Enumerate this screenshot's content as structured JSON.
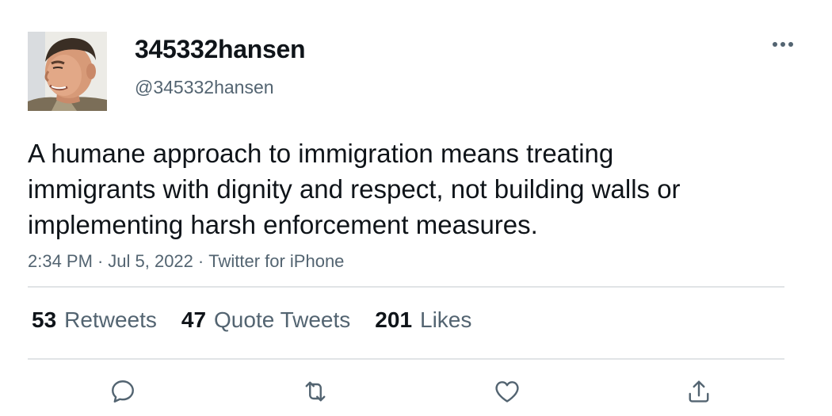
{
  "user": {
    "display_name": "345332hansen",
    "handle": "@345332hansen"
  },
  "tweet": {
    "text": "A humane approach to immigration means treating immigrants with dignity and respect, not building walls or implementing harsh enforcement measures.",
    "time": "2:34 PM",
    "date": "Jul 5, 2022",
    "source": "Twitter for iPhone",
    "separator": "·"
  },
  "stats": {
    "retweets": {
      "count": "53",
      "label": "Retweets"
    },
    "quotes": {
      "count": "47",
      "label": "Quote Tweets"
    },
    "likes": {
      "count": "201",
      "label": "Likes"
    }
  },
  "icons": {
    "more": "more-dots-icon",
    "reply": "reply-icon",
    "retweet": "retweet-icon",
    "like": "heart-icon",
    "share": "share-icon"
  },
  "colors": {
    "text_primary": "#0f1419",
    "text_secondary": "#536471",
    "divider": "#e1e4e6"
  }
}
